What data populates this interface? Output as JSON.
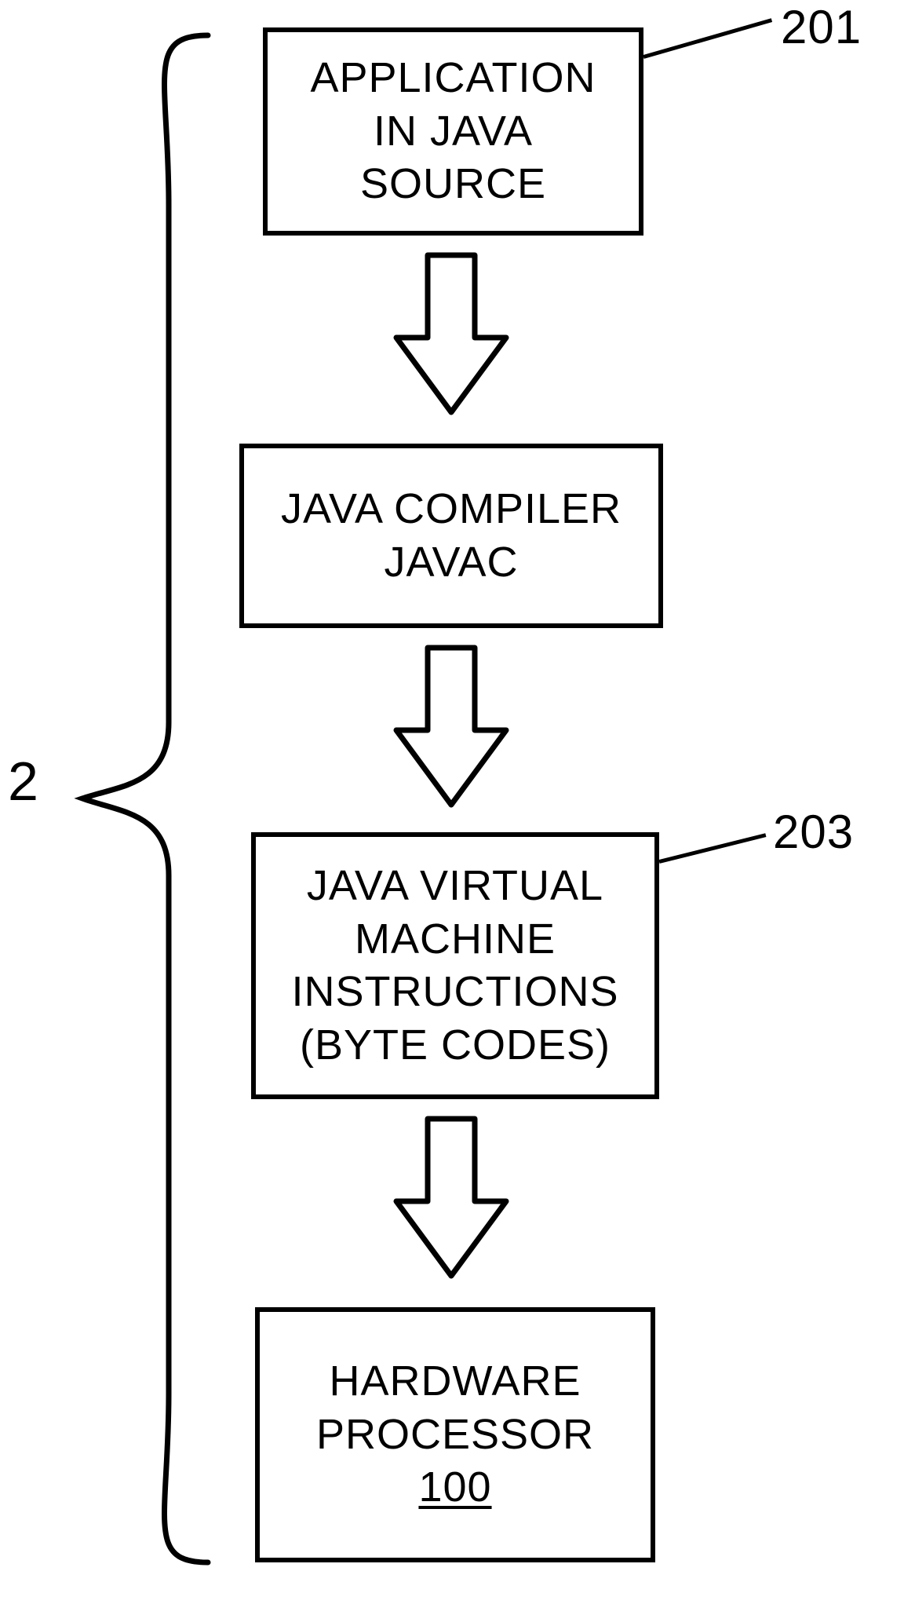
{
  "figure_label": "2",
  "boxes": {
    "b1": {
      "l1": "APPLICATION",
      "l2": "IN JAVA",
      "l3": "SOURCE"
    },
    "b2": {
      "l1": "JAVA COMPILER",
      "l2": "JAVAC"
    },
    "b3": {
      "l1": "JAVA VIRTUAL",
      "l2": "MACHINE",
      "l3": "INSTRUCTIONS",
      "l4": "(BYTE CODES)"
    },
    "b4": {
      "l1": "HARDWARE",
      "l2": "PROCESSOR",
      "ref": "100"
    }
  },
  "callouts": {
    "c1": "201",
    "c3": "203"
  },
  "chart_data": {
    "type": "flowchart",
    "title": "",
    "nodes": [
      {
        "id": "201",
        "label": "APPLICATION IN JAVA SOURCE"
      },
      {
        "id": "n2",
        "label": "JAVA COMPILER JAVAC"
      },
      {
        "id": "203",
        "label": "JAVA VIRTUAL MACHINE INSTRUCTIONS (BYTE CODES)"
      },
      {
        "id": "100",
        "label": "HARDWARE PROCESSOR 100"
      }
    ],
    "edges": [
      {
        "from": "201",
        "to": "n2"
      },
      {
        "from": "n2",
        "to": "203"
      },
      {
        "from": "203",
        "to": "100"
      }
    ],
    "group": {
      "label": "2",
      "members": [
        "201",
        "n2",
        "203",
        "100"
      ]
    }
  }
}
